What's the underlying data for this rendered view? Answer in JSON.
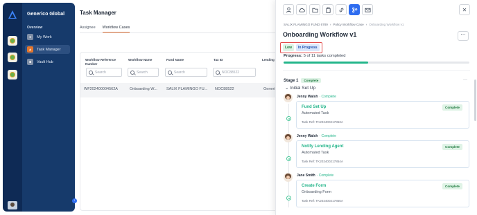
{
  "app": {
    "title": "Generico Global"
  },
  "rail": {
    "apps": [
      "app-icon-1",
      "app-icon-2",
      "app-icon-3"
    ]
  },
  "nav": {
    "section": "Overview",
    "items": [
      {
        "label": "My Work",
        "icon": "user-icon",
        "active": false
      },
      {
        "label": "Task Manager",
        "icon": "bell-icon",
        "active": true
      },
      {
        "label": "Vault Hub",
        "icon": "vault-icon",
        "active": false
      }
    ]
  },
  "main": {
    "title": "Task Manager",
    "tabs": [
      {
        "label": "Assignee",
        "active": false
      },
      {
        "label": "Workflow Cases",
        "active": true
      }
    ],
    "columns": [
      "Workflow Reference Number",
      "Workflow Name",
      "Fund Name",
      "Tax ID",
      "Lending A"
    ],
    "filter_placeholders": [
      "Search",
      "Search",
      "Search",
      "NOC88522"
    ],
    "rows": [
      [
        "WF202400004562A",
        "Onboarding W...",
        "SALIX FLAMINGO FU...",
        "NOC88522",
        "Generi"
      ]
    ]
  },
  "drawer": {
    "toolbar": [
      "user-icon",
      "cloud-icon",
      "folder-icon",
      "clipboard-icon",
      "link-icon",
      "workflow-icon",
      "mail-icon"
    ],
    "active_tool": "workflow-icon",
    "close_glyph": "✕",
    "breadcrumb": [
      "SALIX FLAMINGO FUND 6789",
      "Policy Workflow Case",
      "Onboarding Workflow v1"
    ],
    "title": "Onboarding Workflow v1",
    "badges": {
      "priority": "Low",
      "status": "In Progress"
    },
    "progress": {
      "label": "Progress:",
      "text": "5 of 11 tasks completed",
      "done": 5,
      "total": 11
    },
    "stage": {
      "label": "Stage 1",
      "status": "Complete",
      "section": "Initial Set Up"
    },
    "tasks": [
      {
        "assignee": "Jenny Walsh",
        "state": "Complete",
        "name": "Fund Set Up",
        "type": "Automated Task",
        "ref": "Task Ref: TK202400217853A",
        "status": "Complete"
      },
      {
        "assignee": "Jenny Walsh",
        "state": "Complete",
        "name": "Notify Lending Agent",
        "type": "Automated Task",
        "ref": "Task Ref: TK202400217854A",
        "status": "Complete"
      },
      {
        "assignee": "Jane Smith",
        "state": "Complete",
        "name": "Create Form",
        "type": "Onboarding Form",
        "ref": "Task Ref: TK202400217855A",
        "status": "Complete"
      }
    ]
  },
  "colors": {
    "accent": "#2f6df0",
    "nav_bg": "#163a6b",
    "complete": "#23b58a",
    "tab_underline": "#e06a2c"
  }
}
